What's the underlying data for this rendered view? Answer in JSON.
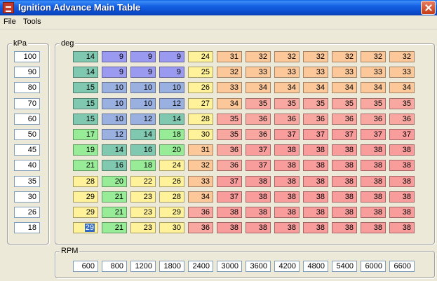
{
  "window": {
    "title": "Ignition Advance Main Table"
  },
  "menu": [
    "File",
    "Tools"
  ],
  "kpa_group": {
    "label": "kPa",
    "values": [
      "100",
      "90",
      "80",
      "70",
      "60",
      "50",
      "45",
      "40",
      "35",
      "30",
      "26",
      "18"
    ]
  },
  "deg_group": {
    "label": "deg"
  },
  "rpm_group": {
    "label": "RPM",
    "values": [
      "600",
      "800",
      "1200",
      "1800",
      "2400",
      "3000",
      "3600",
      "4200",
      "4800",
      "5400",
      "6000",
      "6600"
    ]
  },
  "table": {
    "rows": [
      [
        "14",
        "9",
        "9",
        "9",
        "24",
        "31",
        "32",
        "32",
        "32",
        "32",
        "32",
        "32"
      ],
      [
        "14",
        "9",
        "9",
        "9",
        "25",
        "32",
        "33",
        "33",
        "33",
        "33",
        "33",
        "33"
      ],
      [
        "15",
        "10",
        "10",
        "10",
        "26",
        "33",
        "34",
        "34",
        "34",
        "34",
        "34",
        "34"
      ],
      [
        "15",
        "10",
        "10",
        "12",
        "27",
        "34",
        "35",
        "35",
        "35",
        "35",
        "35",
        "35"
      ],
      [
        "15",
        "10",
        "12",
        "14",
        "28",
        "35",
        "36",
        "36",
        "36",
        "36",
        "36",
        "36"
      ],
      [
        "17",
        "12",
        "14",
        "18",
        "30",
        "35",
        "36",
        "37",
        "37",
        "37",
        "37",
        "37"
      ],
      [
        "19",
        "14",
        "16",
        "20",
        "31",
        "36",
        "37",
        "38",
        "38",
        "38",
        "38",
        "38"
      ],
      [
        "21",
        "16",
        "18",
        "24",
        "32",
        "36",
        "37",
        "38",
        "38",
        "38",
        "38",
        "38"
      ],
      [
        "28",
        "20",
        "22",
        "26",
        "33",
        "37",
        "38",
        "38",
        "38",
        "38",
        "38",
        "38"
      ],
      [
        "29",
        "21",
        "23",
        "28",
        "34",
        "37",
        "38",
        "38",
        "38",
        "38",
        "38",
        "38"
      ],
      [
        "29",
        "21",
        "23",
        "29",
        "36",
        "38",
        "38",
        "38",
        "38",
        "38",
        "38",
        "38"
      ],
      [
        "29",
        "21",
        "23",
        "30",
        "36",
        "38",
        "38",
        "38",
        "38",
        "38",
        "38",
        "38"
      ]
    ],
    "selected_cell": {
      "row": 11,
      "col": 0
    }
  },
  "colors": {
    "violet": "#9a9af0",
    "steel_blue": "#9ab0e0",
    "teal": "#80c8b0",
    "green": "#98ec98",
    "yellow": "#fff29a",
    "orange": "#fcc89a",
    "salmon": "#f8a8a0",
    "red": "#f89c9c",
    "selection": "#316ac5"
  }
}
